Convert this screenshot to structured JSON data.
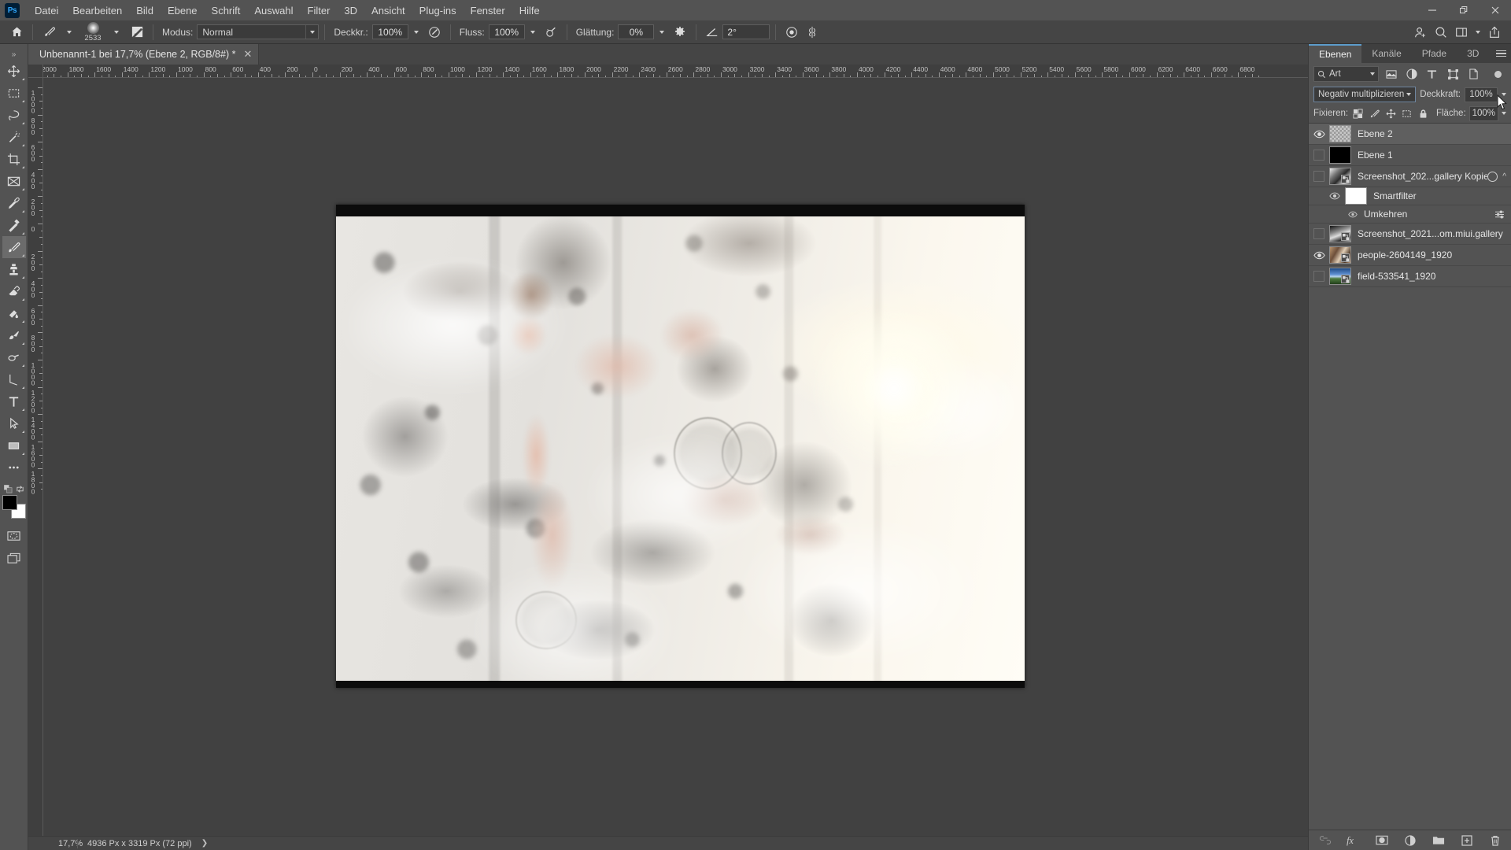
{
  "app": {
    "logo": "Ps",
    "menus": [
      "Datei",
      "Bearbeiten",
      "Bild",
      "Ebene",
      "Schrift",
      "Auswahl",
      "Filter",
      "3D",
      "Ansicht",
      "Plug-ins",
      "Fenster",
      "Hilfe"
    ],
    "window_controls": {
      "minimize": "—",
      "maximize": "❐",
      "close": "✕"
    }
  },
  "options_bar": {
    "home_icon": "home-icon",
    "brush_preset_icon": "brush-preset-icon",
    "brush_size": "2533",
    "brush_panel_icon": "brush-panel-icon",
    "mode_label": "Modus:",
    "mode_value": "Normal",
    "opacity_label": "Deckkr.:",
    "opacity_value": "100%",
    "pressure_opacity_icon": "pressure-opacity-icon",
    "flow_label": "Fluss:",
    "flow_value": "100%",
    "airbrush_icon": "airbrush-icon",
    "smoothing_label": "Glättung:",
    "smoothing_value": "0%",
    "smoothing_options_icon": "gear-icon",
    "angle_icon": "angle-icon",
    "angle_value": "2°",
    "pressure_size_icon": "pressure-size-icon",
    "symmetry_icon": "symmetry-icon"
  },
  "top_right_bar": {
    "share_icon": "share-user-icon",
    "search_icon": "search-icon",
    "workspace_icon": "workspace-icon",
    "workspace_caret": "chevron-down-icon",
    "export_icon": "export-icon"
  },
  "toolbar": {
    "collapse_icon": "double-chevron-icon",
    "tools": [
      {
        "name": "move-tool",
        "active": false
      },
      {
        "name": "rectangular-marquee-tool",
        "active": false
      },
      {
        "name": "lasso-tool",
        "active": false
      },
      {
        "name": "quick-selection-tool",
        "active": false
      },
      {
        "name": "crop-tool",
        "active": false
      },
      {
        "name": "frame-tool",
        "active": false
      },
      {
        "name": "eyedropper-tool",
        "active": false
      },
      {
        "name": "spot-healing-brush-tool",
        "active": false
      },
      {
        "name": "brush-tool",
        "active": true
      },
      {
        "name": "clone-stamp-tool",
        "active": false
      },
      {
        "name": "eraser-tool",
        "active": false
      },
      {
        "name": "gradient-tool",
        "active": false
      },
      {
        "name": "blur-tool",
        "active": false
      },
      {
        "name": "dodge-tool",
        "active": false
      },
      {
        "name": "pen-tool",
        "active": false
      },
      {
        "name": "horizontal-type-tool",
        "active": false
      },
      {
        "name": "path-selection-tool",
        "active": false
      },
      {
        "name": "rectangle-tool",
        "active": false
      },
      {
        "name": "more-tools",
        "active": false
      }
    ],
    "foreground_color": "#000000",
    "background_color": "#ffffff",
    "quick-mask": "quick-mask-icon",
    "screen-mode": "screen-mode-icon"
  },
  "document": {
    "tab_title": "Unbenannt-1 bei 17,7% (Ebene 2, RGB/8#) *",
    "close_icon": "close-icon"
  },
  "rulers": {
    "unit": "Px",
    "h_labels": [
      "2000",
      "1800",
      "1600",
      "1400",
      "1200",
      "1000",
      "800",
      "600",
      "400",
      "200",
      "0",
      "200",
      "400",
      "600",
      "800",
      "1000",
      "1200",
      "1400",
      "1600",
      "1800",
      "2000",
      "2200",
      "2400",
      "2600",
      "2800",
      "3000",
      "3200",
      "3400",
      "3600",
      "3800",
      "4000",
      "4200",
      "4400",
      "4600",
      "4800",
      "5000",
      "5200",
      "5400",
      "5600",
      "5800",
      "6000",
      "6200",
      "6400",
      "6600",
      "6800"
    ],
    "v_labels": [
      "1000",
      "800",
      "600",
      "400",
      "200",
      "0",
      "200",
      "400",
      "600",
      "800",
      "1000",
      "1200",
      "1400",
      "1600",
      "1800"
    ]
  },
  "panels": {
    "tabs": [
      {
        "label": "Ebenen",
        "active": true
      },
      {
        "label": "Kanäle",
        "active": false
      },
      {
        "label": "Pfade",
        "active": false
      },
      {
        "label": "3D",
        "active": false
      }
    ],
    "menu_icon": "panel-menu-icon",
    "filter": {
      "search_icon": "search-icon",
      "kind_value": "Art",
      "caret_icon": "chevron-down-icon",
      "icons": [
        "filter-pixel-icon",
        "filter-adjustment-icon",
        "filter-type-icon",
        "filter-shape-icon",
        "filter-smartobject-icon"
      ],
      "toggle_icon": "filter-toggle-icon"
    },
    "blend": {
      "mode_value": "Negativ multiplizieren",
      "caret_icon": "chevron-down-icon",
      "opacity_label": "Deckkraft:",
      "opacity_value": "100%"
    },
    "lock": {
      "label": "Fixieren:",
      "icons": [
        "lock-transparency-icon",
        "lock-image-icon",
        "lock-position-icon",
        "lock-artboard-icon",
        "lock-all-icon"
      ],
      "fill_label": "Fläche:",
      "fill_value": "100%"
    },
    "layers": [
      {
        "name": "Ebene 2",
        "visible": true,
        "selected": true,
        "thumb": "checker",
        "linked": false,
        "indent": 0,
        "type": "layer"
      },
      {
        "name": "Ebene 1",
        "visible": false,
        "selected": false,
        "thumb": "black",
        "linked": false,
        "indent": 0,
        "type": "layer"
      },
      {
        "name": "Screenshot_202...gallery Kopie",
        "visible": false,
        "selected": false,
        "thumb": "photo1",
        "linked": true,
        "indent": 0,
        "type": "smartobject",
        "has_fx": true,
        "expanded": true
      },
      {
        "name": "Smartfilter",
        "visible": true,
        "selected": false,
        "thumb": "white",
        "indent": 1,
        "type": "smartfilter-mask"
      },
      {
        "name": "Umkehren",
        "visible": true,
        "selected": false,
        "indent": 2,
        "type": "smartfilter-entry",
        "options_icon": "filter-options-icon"
      },
      {
        "name": "Screenshot_2021...om.miui.gallery",
        "visible": false,
        "selected": false,
        "thumb": "photo2",
        "linked": true,
        "indent": 0,
        "type": "smartobject"
      },
      {
        "name": "people-2604149_1920",
        "visible": true,
        "selected": false,
        "thumb": "photo3",
        "linked": true,
        "indent": 0,
        "type": "smartobject"
      },
      {
        "name": "field-533541_1920",
        "visible": false,
        "selected": false,
        "thumb": "photo4",
        "linked": true,
        "indent": 0,
        "type": "smartobject"
      }
    ],
    "footer_icons": [
      "link-layers-icon",
      "layer-style-fx-icon",
      "layer-mask-icon",
      "adjustment-layer-icon",
      "new-group-icon",
      "new-layer-icon",
      "delete-layer-icon"
    ]
  },
  "status_bar": {
    "zoom": "17,7%",
    "doc_size": "4936 Px x 3319 Px (72 ppi)",
    "expand_icon": "chevron-right-icon"
  },
  "colors": {
    "window_bg": "#535353",
    "panel_bg": "#535353",
    "options_bg": "#454545",
    "canvas_bg": "#414141",
    "accent_blue": "#5c9ccb",
    "ps_logo_bg": "#001e36",
    "ps_logo_fg": "#31a8ff",
    "text": "#d4d4d4"
  }
}
